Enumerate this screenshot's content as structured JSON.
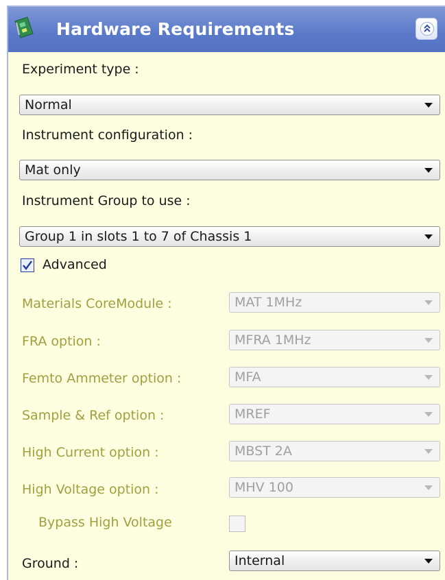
{
  "header": {
    "title": "Hardware Requirements",
    "app_icon": "circuit-board-icon",
    "collapse_icon": "chevron-double-up-icon"
  },
  "experiment_type": {
    "label": "Experiment type :",
    "value": "Normal"
  },
  "instrument_configuration": {
    "label": "Instrument configuration :",
    "value": "Mat only"
  },
  "instrument_group": {
    "label": "Instrument Group to use :",
    "value": "Group 1 in slots 1 to 7 of Chassis 1"
  },
  "advanced": {
    "label": "Advanced",
    "checked": true
  },
  "options": [
    {
      "label": "Materials CoreModule :",
      "value": "MAT 1MHz"
    },
    {
      "label": "FRA option :",
      "value": "MFRA 1MHz"
    },
    {
      "label": "Femto Ammeter option :",
      "value": "MFA"
    },
    {
      "label": "Sample & Ref option :",
      "value": "MREF"
    },
    {
      "label": "High Current option :",
      "value": "MBST 2A"
    },
    {
      "label": "High Voltage option :",
      "value": "MHV 100"
    }
  ],
  "bypass": {
    "label": "Bypass High Voltage",
    "checked": false
  },
  "ground": {
    "label": "Ground :",
    "value": "Internal"
  },
  "colors": {
    "header": "#5a79c8",
    "panel": "#fdfde0",
    "disabled_label": "#a1a040"
  }
}
